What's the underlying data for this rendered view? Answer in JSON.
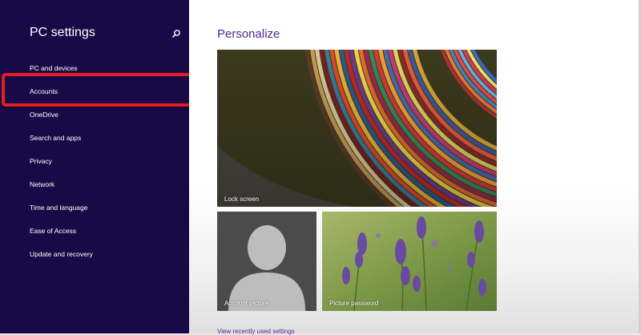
{
  "sidebar": {
    "title": "PC settings",
    "items": [
      {
        "label": "PC and devices"
      },
      {
        "label": "Accounts"
      },
      {
        "label": "OneDrive"
      },
      {
        "label": "Search and apps"
      },
      {
        "label": "Privacy"
      },
      {
        "label": "Network"
      },
      {
        "label": "Time and language"
      },
      {
        "label": "Ease of Access"
      },
      {
        "label": "Update and recovery"
      }
    ]
  },
  "main": {
    "title": "Personalize",
    "tiles": {
      "lock_screen": "Lock screen",
      "account_picture": "Account picture",
      "picture_password": "Picture password"
    },
    "bottom_link": "View recently used settings"
  },
  "colors": {
    "sidebar_bg": "#180a46",
    "accent": "#4e2a8e",
    "highlight": "#e51c24"
  },
  "icons": {
    "search": "search-icon"
  }
}
